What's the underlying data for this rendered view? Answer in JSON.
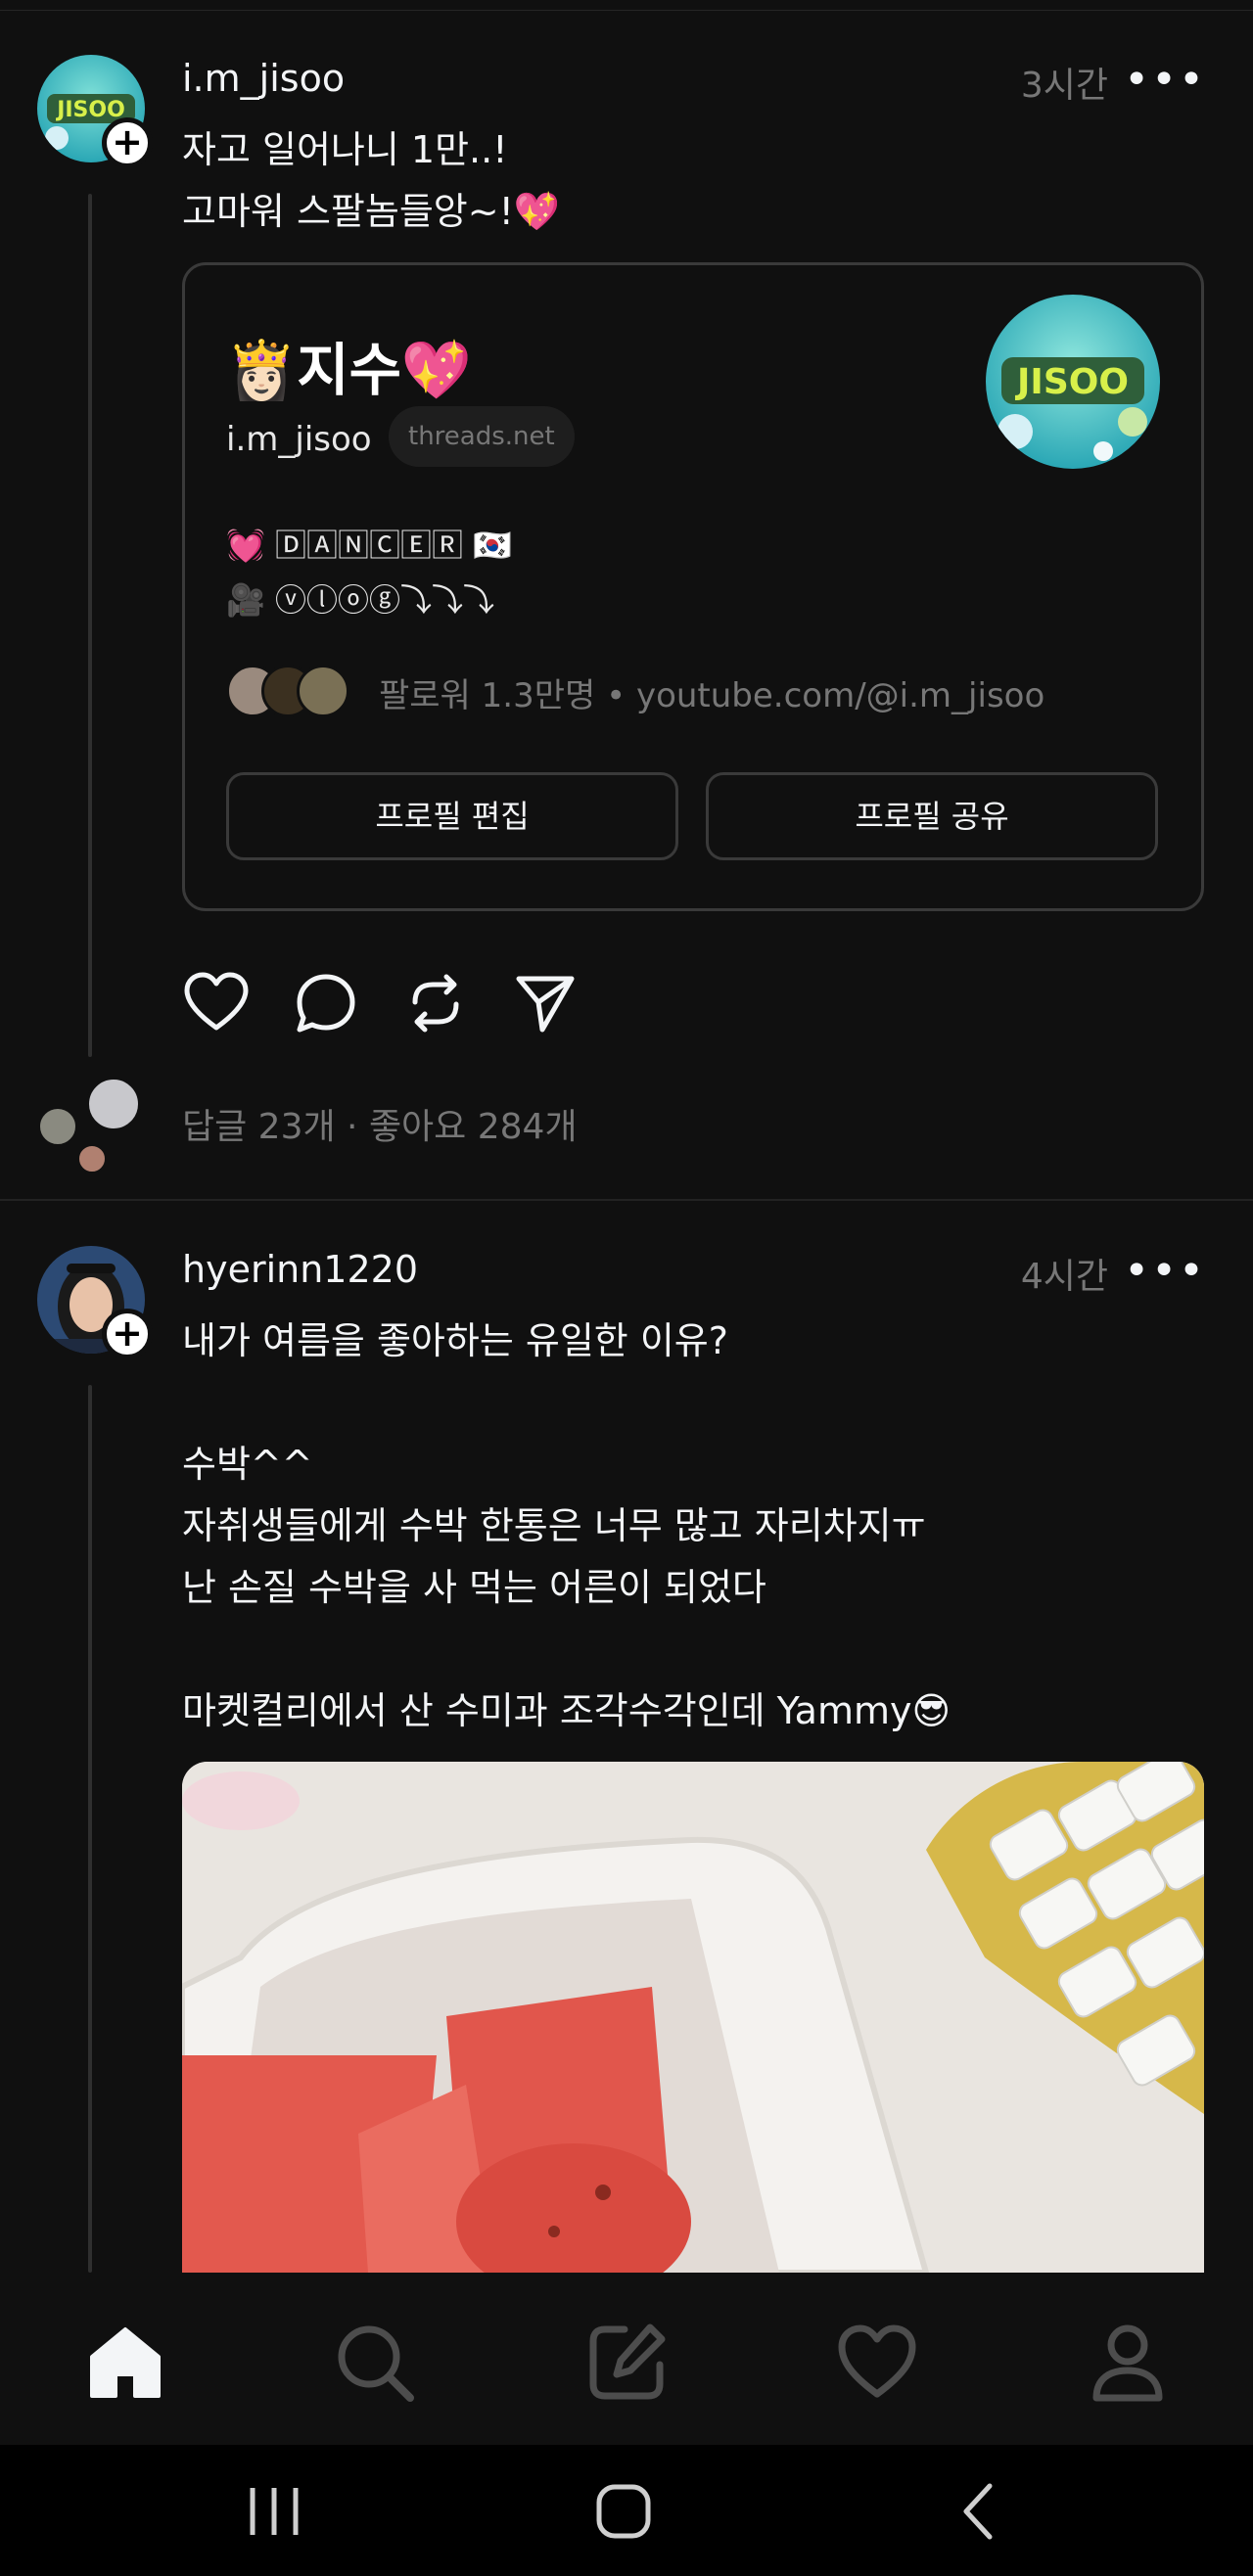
{
  "posts": [
    {
      "username": "i.m_jisoo",
      "time": "3시간",
      "more_label": "•••",
      "text": "자고 일어나니 1만..!\n고마워 스팔놈들앙~!💖",
      "avatar_text": "JISOO",
      "card": {
        "name": "👸🏻지수💖",
        "handle": "i.m_jisoo",
        "domain_pill": "threads.net",
        "bio": "💓 🄳🄰🄽🄲🄴🅁 🇰🇷\n🎥 ⓥⓛⓞⓖ⤵︎⤵︎⤵︎",
        "meta": "팔로워 1.3만명 • youtube.com/@i.m_jisoo",
        "edit_button": "프로필 편집",
        "share_button": "프로필 공유"
      },
      "stats": "답글 23개 · 좋아요 284개"
    },
    {
      "username": "hyerinn1220",
      "time": "4시간",
      "more_label": "•••",
      "text": "내가 여름을 좋아하는 유일한 이유?\n\n수박^^\n자취생들에게 수박 한통은 너무 많고 자리차지ㅠ\n난 손질 수박을 사 먹는 어른이 되었다\n\n마켓컬리에서 산 수미과 조각수각인데 Yammy😎"
    }
  ],
  "icons": {
    "actions": [
      "heart-icon",
      "comment-icon",
      "repost-icon",
      "share-icon"
    ],
    "tabs": [
      "home-icon",
      "search-icon",
      "compose-icon",
      "activity-heart-icon",
      "profile-icon"
    ],
    "system_nav": [
      "recents-icon",
      "home-button-icon",
      "back-icon"
    ]
  },
  "colors": {
    "background": "#101010",
    "text": "#f3f5f7",
    "muted": "#777777",
    "border": "#3a3a3a",
    "avatar_teal": "#5cc8c8"
  }
}
